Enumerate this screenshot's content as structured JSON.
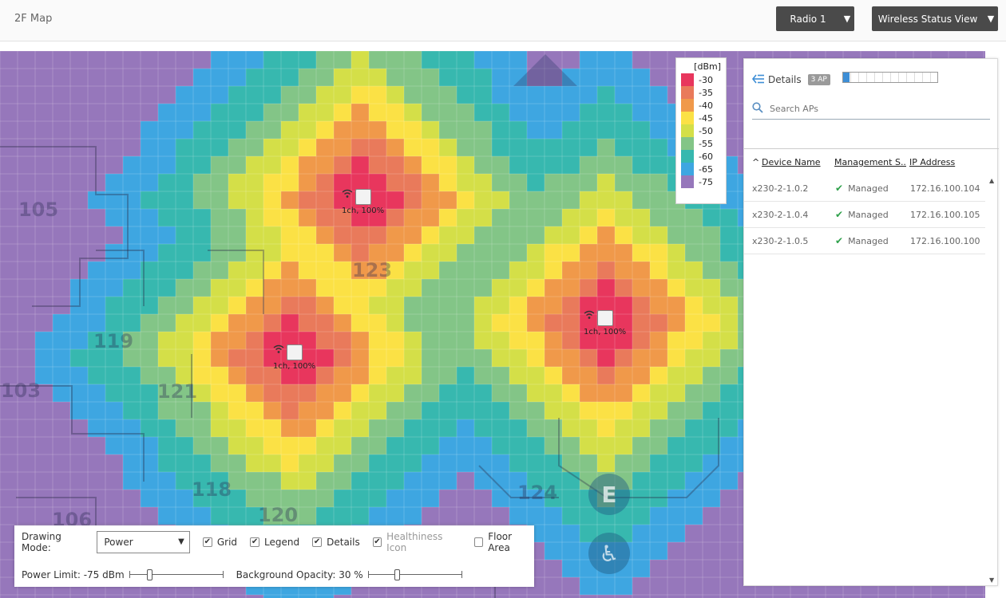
{
  "header": {
    "title": "2F Map",
    "radio_label": "Radio 1",
    "view_label": "Wireless Status View"
  },
  "map": {
    "room_labels": [
      "105",
      "123",
      "119",
      "121",
      "103",
      "118",
      "120",
      "124",
      "106"
    ],
    "aps": [
      {
        "label": "1ch, 100%"
      },
      {
        "label": "1ch, 100%"
      },
      {
        "label": "1ch, 100%"
      }
    ]
  },
  "legend": {
    "title": "[dBm]",
    "items": [
      {
        "value": "-30",
        "color": "#e8365d"
      },
      {
        "value": "-35",
        "color": "#e97a5b"
      },
      {
        "value": "-40",
        "color": "#f0994a"
      },
      {
        "value": "-45",
        "color": "#fbe145"
      },
      {
        "value": "-50",
        "color": "#d4df48"
      },
      {
        "value": "-55",
        "color": "#83c587"
      },
      {
        "value": "-60",
        "color": "#37b8af"
      },
      {
        "value": "-65",
        "color": "#3ea6e1"
      },
      {
        "value": "-75",
        "color": "#9677bb"
      }
    ]
  },
  "details": {
    "label": "Details",
    "ap_count": "3 AP",
    "search_placeholder": "Search APs",
    "columns": [
      "Device Name",
      "Management S...",
      "IP Address"
    ],
    "rows": [
      {
        "name": "x230-2-1.0.2",
        "status": "Managed",
        "ip": "172.16.100.104"
      },
      {
        "name": "x230-2-1.0.4",
        "status": "Managed",
        "ip": "172.16.100.105"
      },
      {
        "name": "x230-2-1.0.5",
        "status": "Managed",
        "ip": "172.16.100.100"
      }
    ]
  },
  "controls": {
    "drawing_mode_label": "Drawing Mode:",
    "drawing_mode_value": "Power",
    "checkboxes": [
      {
        "label": "Grid",
        "checked": true
      },
      {
        "label": "Legend",
        "checked": true
      },
      {
        "label": "Details",
        "checked": true
      },
      {
        "label": "Healthiness Icon",
        "checked": true,
        "disabled": true
      },
      {
        "label": "Floor Area",
        "checked": false
      }
    ],
    "power_limit_label": "Power Limit: -75 dBm",
    "power_limit_fraction": 0.2,
    "bg_opacity_label": "Background Opacity: 30 %",
    "bg_opacity_fraction": 0.3
  },
  "colors": {
    "header_button": "#4a4a4a",
    "managed_check": "#2ea04a",
    "accent": "#3d8ed6"
  }
}
